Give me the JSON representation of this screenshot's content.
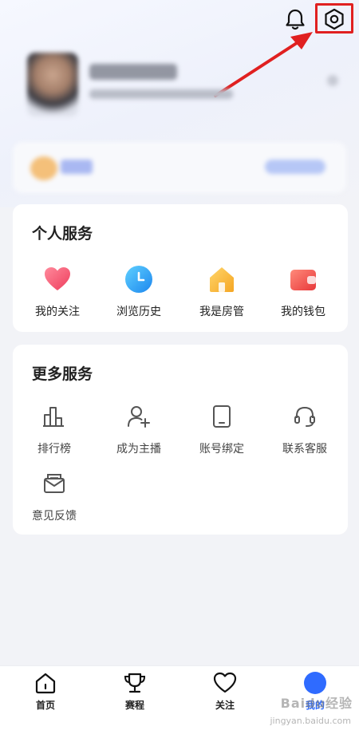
{
  "personal_services": {
    "title": "个人服务",
    "items": [
      {
        "label": "我的关注",
        "icon": "heart-icon",
        "color": "#f24f6a"
      },
      {
        "label": "浏览历史",
        "icon": "clock-icon",
        "color": "#2fa3f4"
      },
      {
        "label": "我是房管",
        "icon": "house-icon",
        "color": "#f8b12f"
      },
      {
        "label": "我的钱包",
        "icon": "wallet-icon",
        "color": "#f0534a"
      }
    ]
  },
  "more_services": {
    "title": "更多服务",
    "items": [
      {
        "label": "排行榜",
        "icon": "ranking-icon"
      },
      {
        "label": "成为主播",
        "icon": "add-user-icon"
      },
      {
        "label": "账号绑定",
        "icon": "tablet-icon"
      },
      {
        "label": "联系客服",
        "icon": "headset-icon"
      },
      {
        "label": "意见反馈",
        "icon": "mail-icon"
      }
    ]
  },
  "tabbar": {
    "items": [
      {
        "label": "首页",
        "icon": "home-icon"
      },
      {
        "label": "赛程",
        "icon": "trophy-icon"
      },
      {
        "label": "关注",
        "icon": "heart-outline-icon"
      },
      {
        "label": "我的",
        "icon": "me-icon",
        "active": true
      }
    ]
  },
  "colors": {
    "accent": "#2f6bff",
    "highlight": "#e02020"
  },
  "watermark": {
    "text": "Baidu经验",
    "sub": "jingyan.baidu.com"
  }
}
